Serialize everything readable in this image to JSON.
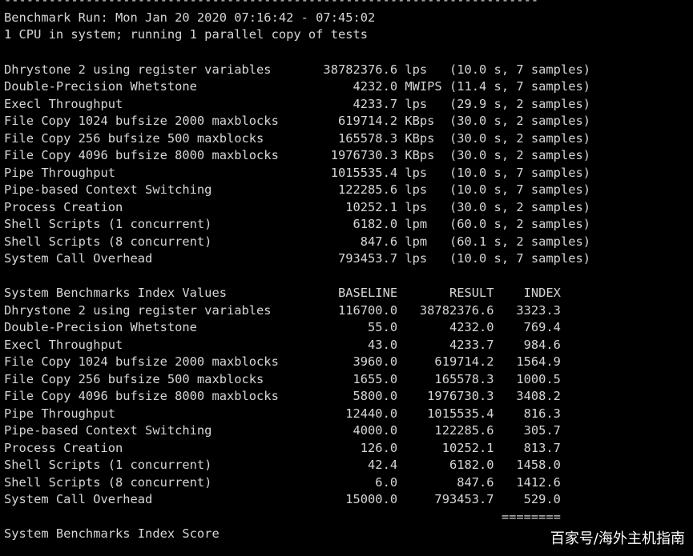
{
  "terminal": {
    "lines": [
      "------------------------------------------------------------------------",
      "Benchmark Run: Mon Jan 20 2020 07:16:42 - 07:45:02",
      "1 CPU in system; running 1 parallel copy of tests",
      "",
      "Dhrystone 2 using register variables       38782376.6 lps   (10.0 s, 7 samples)",
      "Double-Precision Whetstone                     4232.0 MWIPS (11.4 s, 7 samples)",
      "Execl Throughput                               4233.7 lps   (29.9 s, 2 samples)",
      "File Copy 1024 bufsize 2000 maxblocks        619714.2 KBps  (30.0 s, 2 samples)",
      "File Copy 256 bufsize 500 maxblocks          165578.3 KBps  (30.0 s, 2 samples)",
      "File Copy 4096 bufsize 8000 maxblocks       1976730.3 KBps  (30.0 s, 2 samples)",
      "Pipe Throughput                             1015535.4 lps   (10.0 s, 7 samples)",
      "Pipe-based Context Switching                 122285.6 lps   (10.0 s, 7 samples)",
      "Process Creation                              10252.1 lps   (30.0 s, 2 samples)",
      "Shell Scripts (1 concurrent)                   6182.0 lpm   (60.0 s, 2 samples)",
      "Shell Scripts (8 concurrent)                    847.6 lpm   (60.1 s, 2 samples)",
      "System Call Overhead                         793453.7 lps   (10.0 s, 7 samples)",
      "",
      "System Benchmarks Index Values               BASELINE       RESULT    INDEX",
      "Dhrystone 2 using register variables         116700.0   38782376.6   3323.3",
      "Double-Precision Whetstone                       55.0       4232.0    769.4",
      "Execl Throughput                                 43.0       4233.7    984.6",
      "File Copy 1024 bufsize 2000 maxblocks          3960.0     619714.2   1564.9",
      "File Copy 256 bufsize 500 maxblocks            1655.0     165578.3   1000.5",
      "File Copy 4096 bufsize 8000 maxblocks          5800.0    1976730.3   3408.2",
      "Pipe Throughput                               12440.0    1015535.4    816.3",
      "Pipe-based Context Switching                   4000.0     122285.6    305.7",
      "Process Creation                                126.0      10252.1    813.7",
      "Shell Scripts (1 concurrent)                     42.4       6182.0   1458.0",
      "Shell Scripts (8 concurrent)                      6.0        847.6   1412.6",
      "System Call Overhead                          15000.0     793453.7    529.0",
      "                                                                   ========",
      "System Benchmarks Index Score"
    ]
  },
  "watermark": "百家号/海外主机指南"
}
